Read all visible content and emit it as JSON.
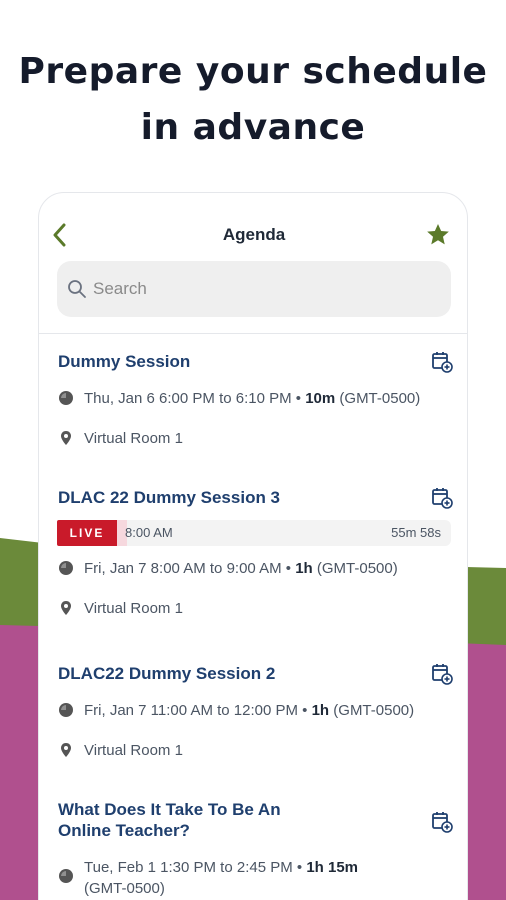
{
  "headline": {
    "line1": "Prepare your schedule",
    "line2": "in advance"
  },
  "header": {
    "title": "Agenda",
    "back_icon": "chevron-left-icon",
    "favorite_icon": "star-icon"
  },
  "search": {
    "placeholder": "Search"
  },
  "colors": {
    "accent": "#5b7a2a",
    "title": "#1f3f6e",
    "live": "#c91a2a",
    "bg_green": "#6b8a3a",
    "bg_magenta": "#b0508e"
  },
  "sessions": [
    {
      "title": "Dummy Session",
      "datetime": "Thu, Jan 6 6:00 PM to 6:10 PM • ",
      "duration": "10m",
      "tz": " (GMT-0500)",
      "location": "Virtual Room 1"
    },
    {
      "title": "DLAC 22 Dummy Session 3",
      "live": {
        "badge": "LIVE",
        "start": "8:00 AM",
        "remaining": "55m 58s",
        "progress": 0.03
      },
      "datetime": "Fri, Jan 7 8:00 AM to 9:00 AM • ",
      "duration": "1h",
      "tz": " (GMT-0500)",
      "location": "Virtual Room 1"
    },
    {
      "title": "DLAC22 Dummy Session 2",
      "datetime": "Fri, Jan 7 11:00 AM to 12:00 PM • ",
      "duration": "1h",
      "tz": " (GMT-0500)",
      "location": "Virtual Room 1"
    },
    {
      "title": "What Does It Take To Be An Online Teacher?",
      "datetime": "Tue, Feb 1 1:30 PM to 2:45 PM • ",
      "duration": "1h 15m",
      "tz": " (GMT-0500)"
    }
  ]
}
